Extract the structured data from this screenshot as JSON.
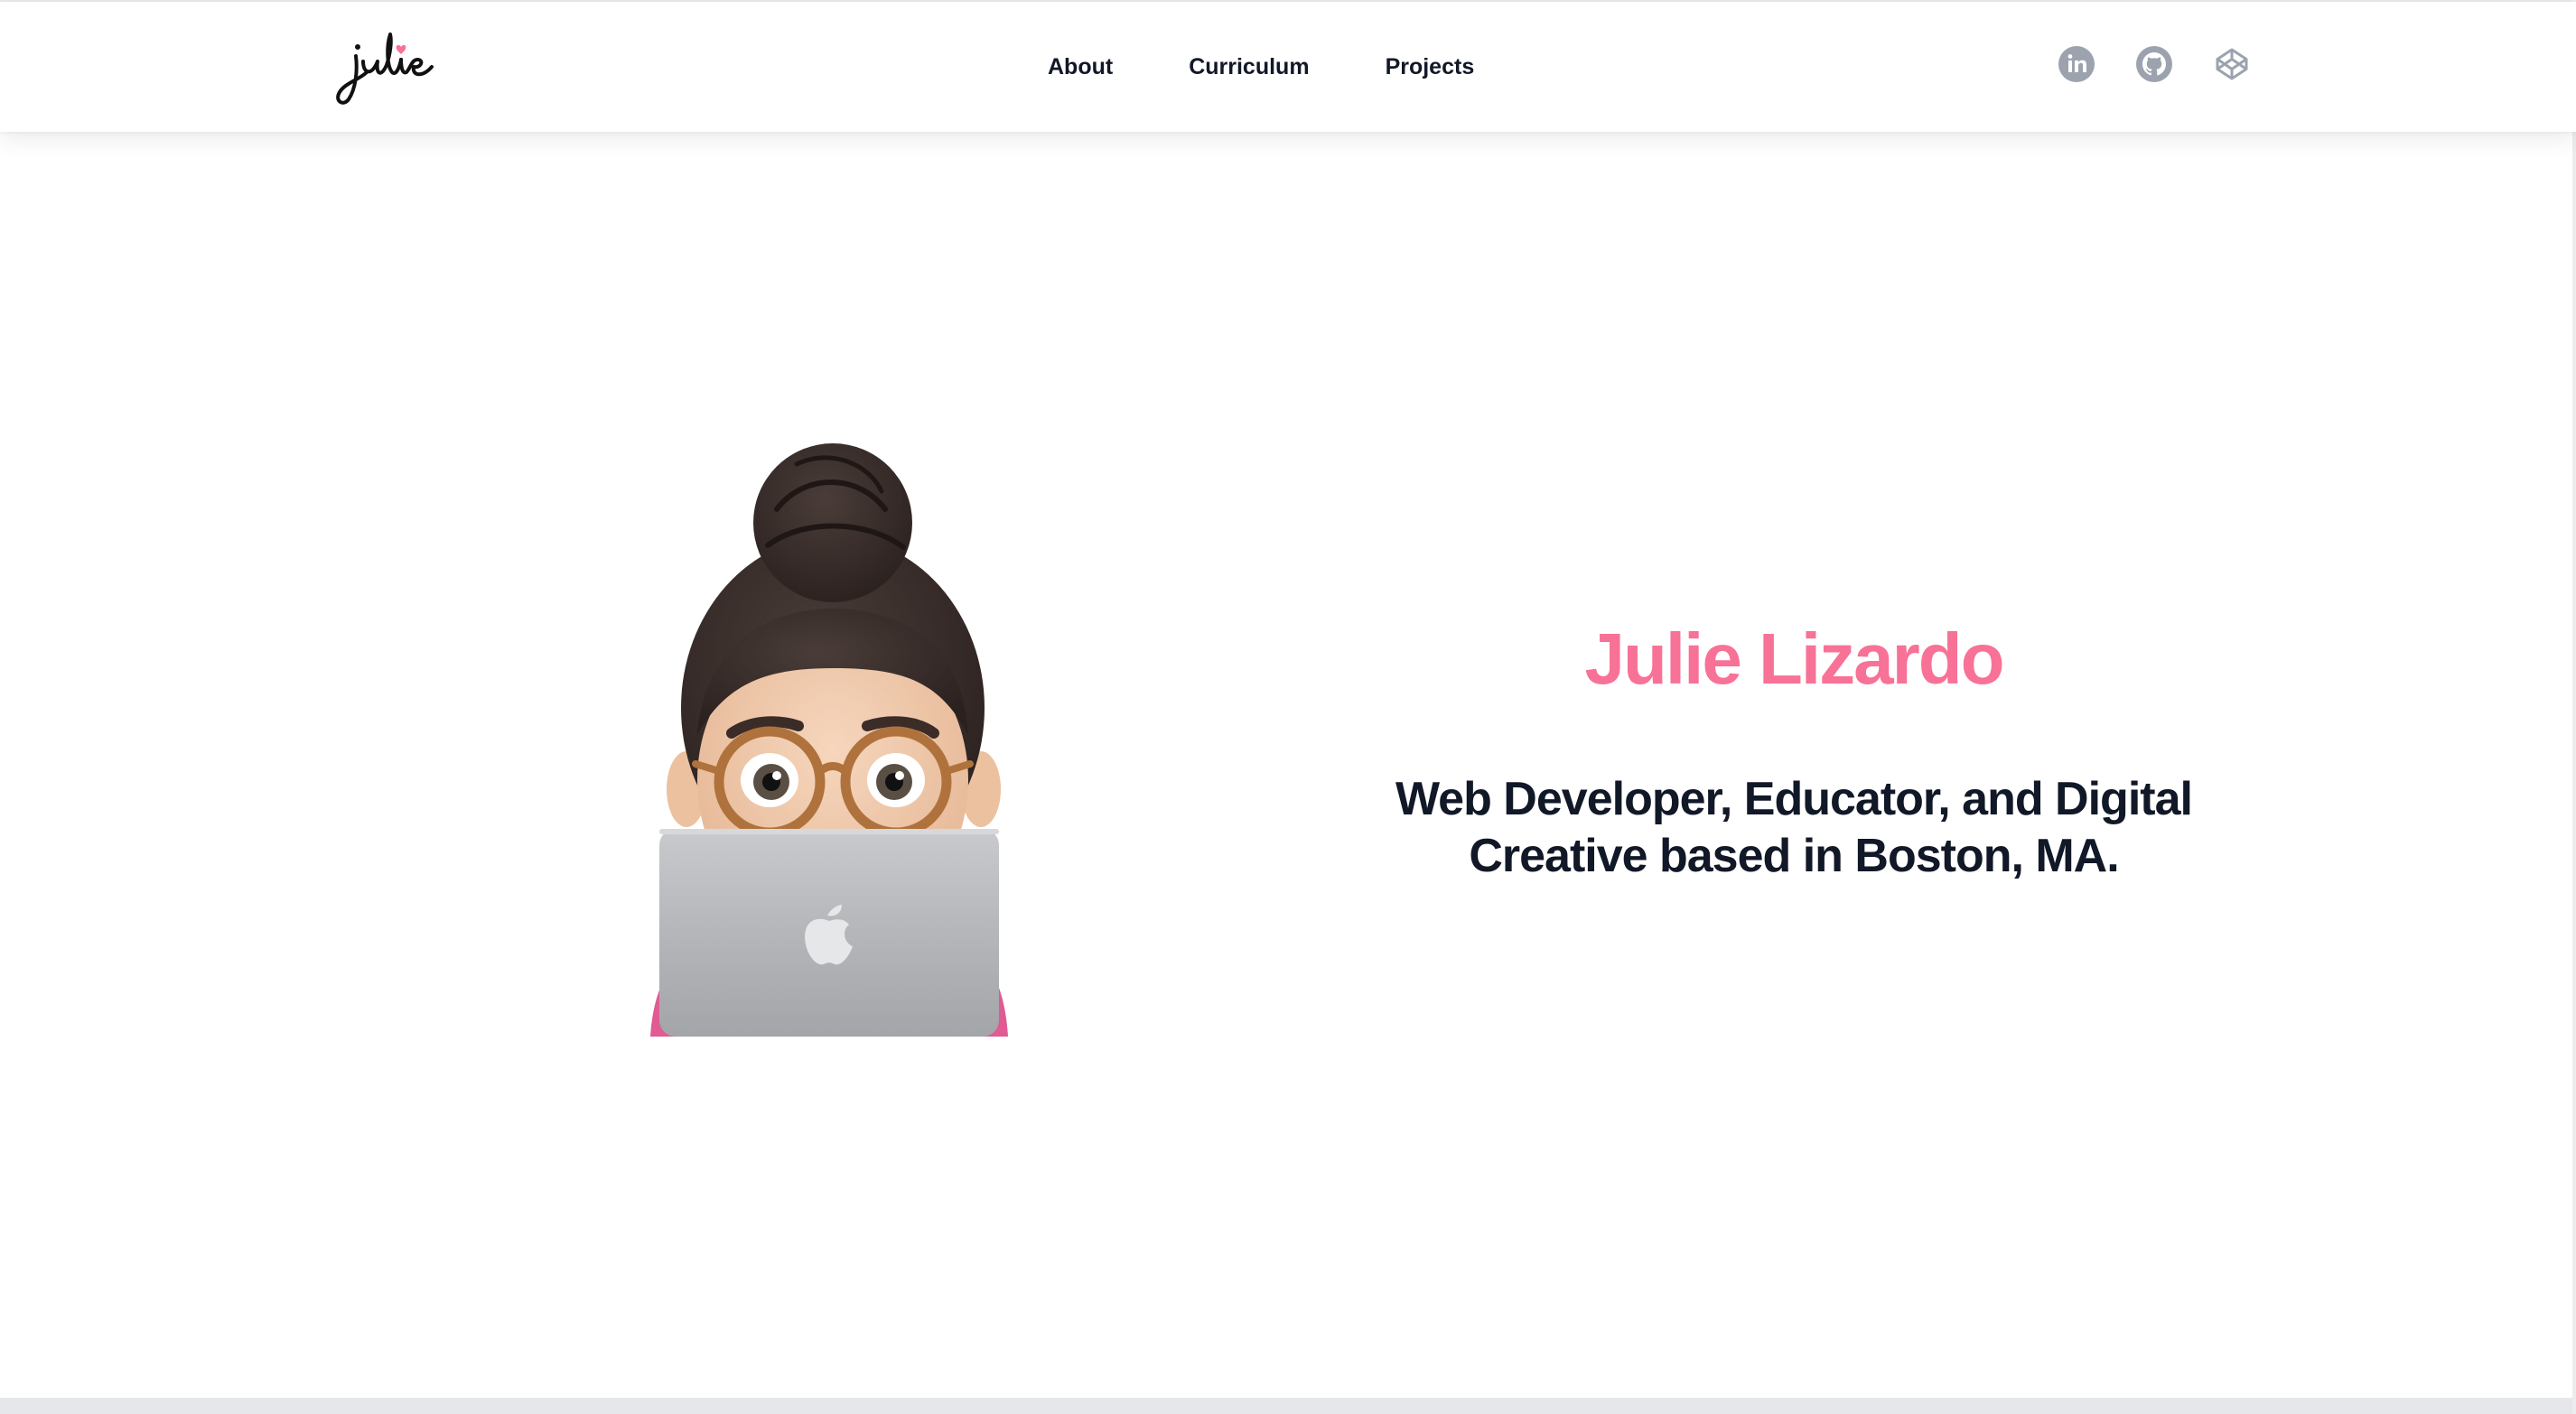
{
  "header": {
    "logo_text": "julie",
    "nav": [
      {
        "label": "About"
      },
      {
        "label": "Curriculum"
      },
      {
        "label": "Projects"
      }
    ],
    "social": [
      {
        "icon": "linkedin-icon",
        "label": "LinkedIn"
      },
      {
        "icon": "github-icon",
        "label": "GitHub"
      },
      {
        "icon": "codepen-icon",
        "label": "CodePen"
      }
    ]
  },
  "hero": {
    "name": "Julie Lizardo",
    "tagline": "Web Developer, Educator, and Digital Creative based in Boston, MA.",
    "avatar": "memoji-avatar-with-laptop"
  },
  "colors": {
    "accent": "#f87196",
    "text": "#111827",
    "icon": "#9ca3af"
  }
}
